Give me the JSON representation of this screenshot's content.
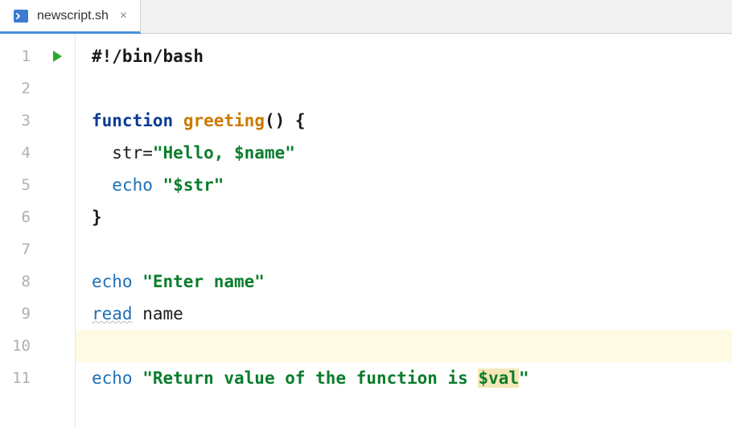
{
  "tab": {
    "filename": "newscript.sh",
    "close_glyph": "×",
    "icon_name": "terminal-file-icon"
  },
  "gutter": {
    "lines": [
      "1",
      "2",
      "3",
      "4",
      "5",
      "6",
      "7",
      "8",
      "9",
      "10",
      "11"
    ]
  },
  "run_marker_line": 1,
  "highlighted_line": 10,
  "code": {
    "l1": {
      "shebang": "#!/bin/bash"
    },
    "l3": {
      "kw": "function",
      "sp": " ",
      "fn": "greeting",
      "rest": "() {"
    },
    "l4": {
      "indent": "  ",
      "lhs": "str=",
      "str": "\"Hello, $name\""
    },
    "l5": {
      "indent": "  ",
      "cmd": "echo",
      "sp": " ",
      "str": "\"$str\""
    },
    "l6": {
      "txt": "}"
    },
    "l8": {
      "cmd": "echo",
      "sp": " ",
      "str": "\"Enter name\""
    },
    "l9": {
      "cmd": "read",
      "sp": " ",
      "var": "name"
    },
    "l11": {
      "cmd": "echo",
      "sp": " ",
      "str_a": "\"Return value of the function is ",
      "var": "$val",
      "str_b": "\""
    }
  }
}
